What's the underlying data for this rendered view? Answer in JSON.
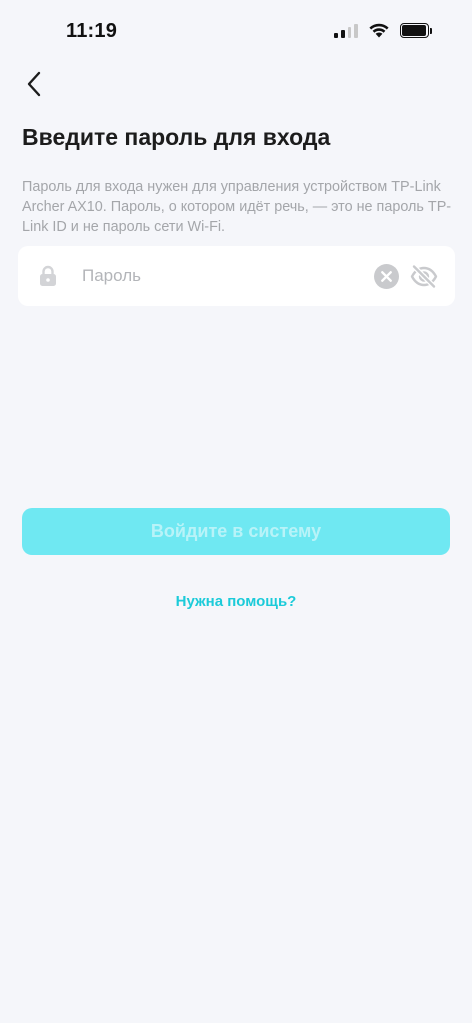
{
  "status_bar": {
    "time": "11:19",
    "signal_icon": "cellular-signal-icon",
    "wifi_icon": "wifi-icon",
    "battery_icon": "battery-icon"
  },
  "header": {
    "back_icon": "chevron-left-icon",
    "title": "Введите пароль для входа"
  },
  "description": "Пароль для входа нужен для управления устройством TP-Link Archer AX10. Пароль, о котором идёт речь, — это не пароль TP-Link ID и не пароль сети Wi-Fi.",
  "password_field": {
    "placeholder": "Пароль",
    "value": "",
    "lock_icon": "lock-icon",
    "clear_icon": "clear-icon",
    "visibility_icon": "eye-off-icon"
  },
  "login_button": {
    "label": "Войдите в систему",
    "enabled": false
  },
  "help_link": {
    "label": "Нужна помощь?"
  },
  "colors": {
    "background": "#f5f6fa",
    "accent": "#1ccbd9",
    "button_disabled": "#6fe8f2",
    "muted_text": "#a4a6aa"
  }
}
